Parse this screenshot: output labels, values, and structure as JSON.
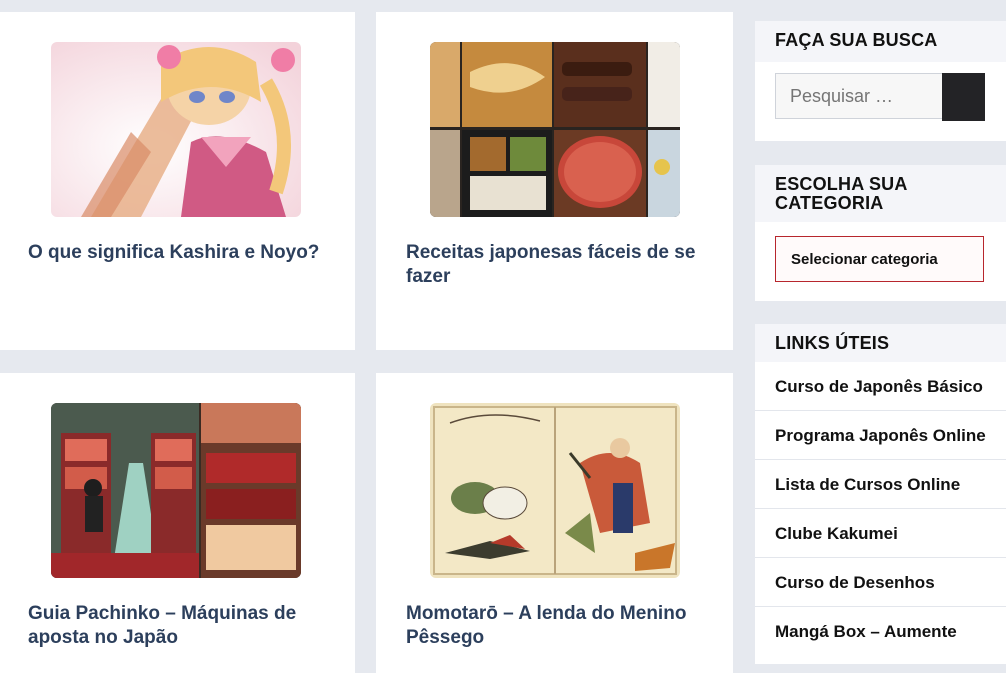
{
  "posts": [
    {
      "title": "O que significa Kashira e Noyo?",
      "image": "anime-girl-pink"
    },
    {
      "title": "Receitas japonesas fáceis de se fazer",
      "image": "japanese-food-collage"
    },
    {
      "title": "Guia Pachinko – Máquinas de aposta no Japão",
      "image": "pachinko-parlor"
    },
    {
      "title": "Momotarō – A lenda do Menino Pêssego",
      "image": "momotaro-woodblock"
    }
  ],
  "sidebar": {
    "search": {
      "title": "FAÇA SUA BUSCA",
      "placeholder": "Pesquisar …",
      "button_icon": "search-icon"
    },
    "category": {
      "title": "ESCOLHA SUA CATEGORIA",
      "select_label": "Selecionar categoria"
    },
    "links": {
      "title": "LINKS ÚTEIS",
      "items": [
        "Curso de Japonês Básico",
        "Programa Japonês Online",
        "Lista de Cursos Online",
        "Clube Kakumei",
        "Curso de Desenhos",
        "Mangá Box – Aumente"
      ]
    }
  },
  "colors": {
    "page_bg": "#e6e9ef",
    "post_title": "#2c3f5c",
    "select_border": "#b7262d",
    "search_button": "#232326"
  }
}
